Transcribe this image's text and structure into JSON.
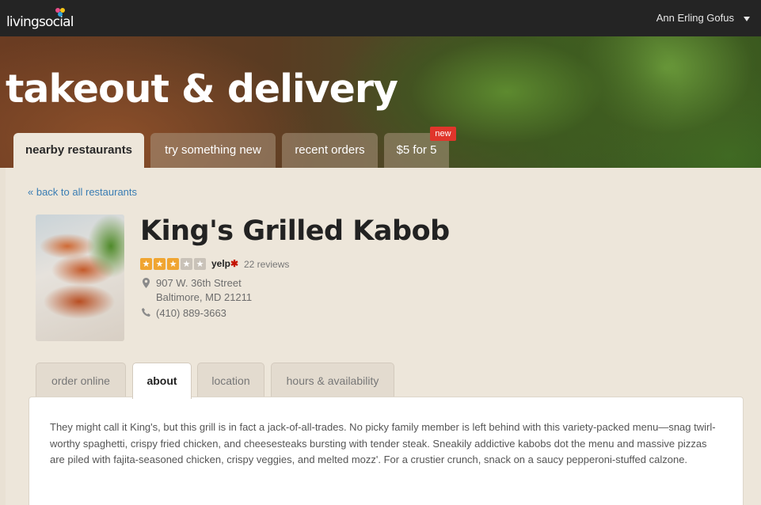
{
  "header": {
    "logo_text": "livingsocial",
    "user_name": "Ann Erling Gofus",
    "user_menu_icon": "caret-down-icon"
  },
  "hero": {
    "title": "takeout & delivery"
  },
  "main_tabs": [
    {
      "label": "nearby restaurants",
      "active": true
    },
    {
      "label": "try something new",
      "active": false
    },
    {
      "label": "recent orders",
      "active": false
    },
    {
      "label": "$5 for 5",
      "active": false,
      "badge": "new"
    }
  ],
  "back_link": "« back to all restaurants",
  "restaurant": {
    "name": "King's Grilled Kabob",
    "rating_stars": 3,
    "rating_max": 5,
    "rating_source": "yelp",
    "reviews": "22 reviews",
    "address_line1": "907 W. 36th Street",
    "address_line2": "Baltimore, MD 21211",
    "phone": "(410) 889-3663",
    "photo_icon": "restaurant-photo"
  },
  "sub_tabs": [
    {
      "label": "order online",
      "active": false
    },
    {
      "label": "about",
      "active": true
    },
    {
      "label": "location",
      "active": false
    },
    {
      "label": "hours & availability",
      "active": false
    }
  ],
  "about_text": "They might call it King's, but this grill is in fact a jack-of-all-trades. No picky family member is left behind with this variety-packed menu—snag twirl-worthy spaghetti, crispy fried chicken, and cheesesteaks bursting with tender steak. Sneakily addictive kabobs dot the menu and massive pizzas are piled with fajita-seasoned chicken, crispy veggies, and melted mozz'. For a crustier crunch, snack on a saucy pepperoni-stuffed calzone.",
  "colors": {
    "topbar": "#242424",
    "panel": "#ede6da",
    "link": "#3a7db3",
    "star_on": "#f0a531",
    "badge": "#e0352b"
  }
}
